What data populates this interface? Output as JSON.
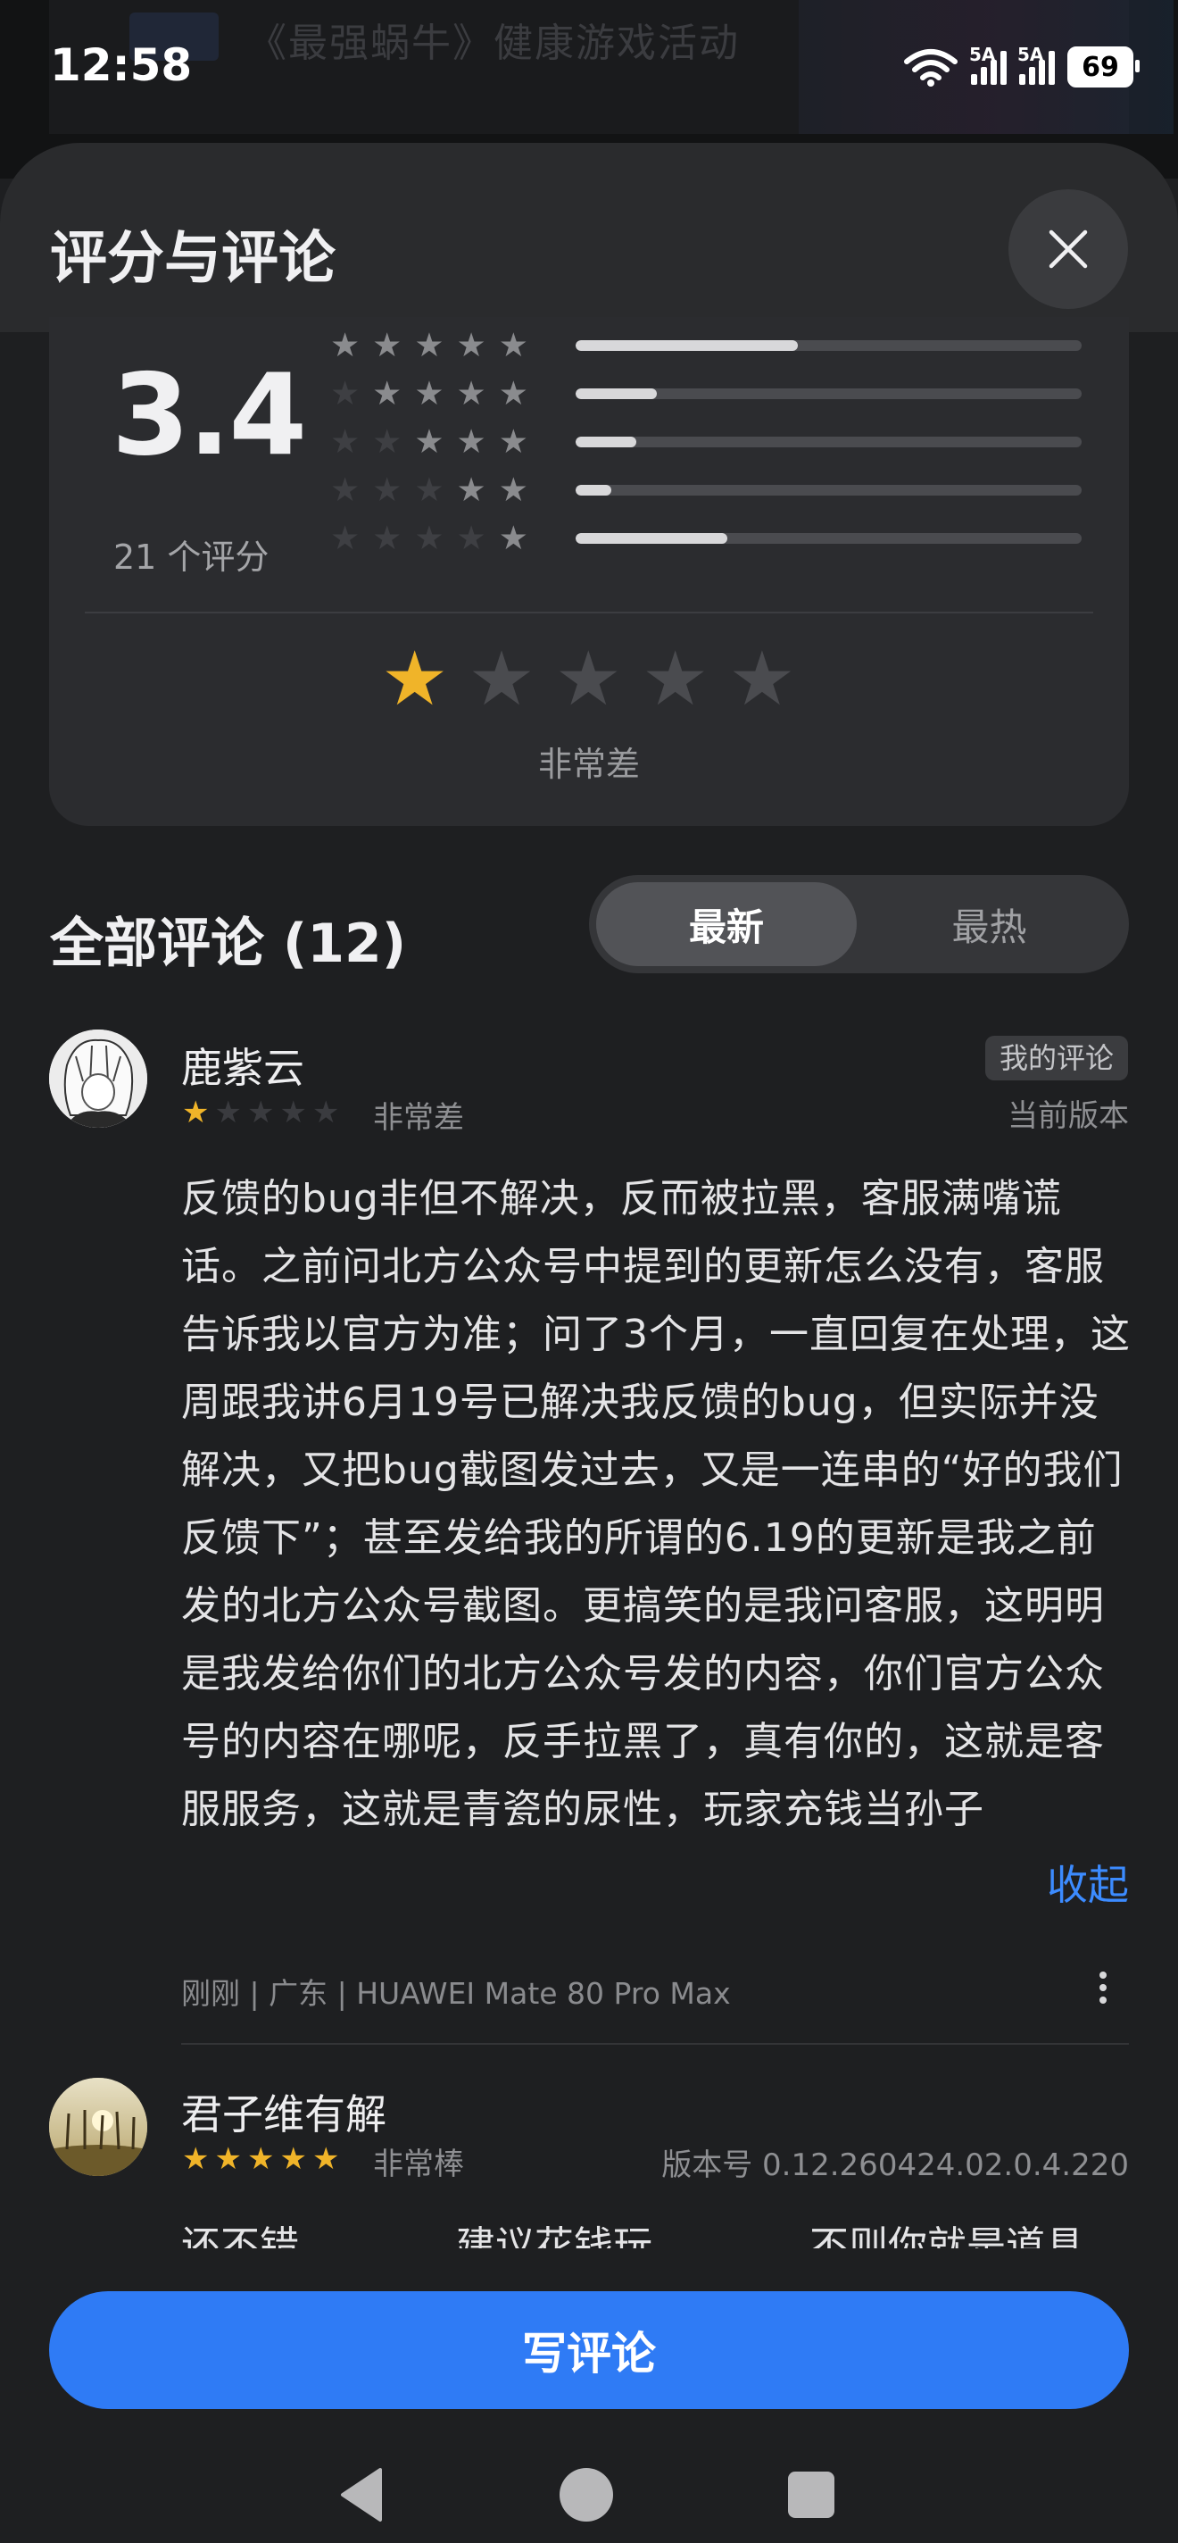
{
  "status_bar": {
    "time": "12:58",
    "battery": "69",
    "signal1_label": "5A",
    "signal2_label": "5A",
    "wifi_label": "6"
  },
  "background_app": {
    "title_text": "《最强蜗牛》健康游戏活动"
  },
  "sheet": {
    "title": "评分与评论"
  },
  "rating_summary": {
    "score": "3.4",
    "count_label": "21 个评分",
    "distribution": [
      {
        "stars": 5,
        "fraction": 0.44
      },
      {
        "stars": 4,
        "fraction": 0.16
      },
      {
        "stars": 3,
        "fraction": 0.12
      },
      {
        "stars": 2,
        "fraction": 0.07
      },
      {
        "stars": 1,
        "fraction": 0.3
      }
    ],
    "my_rating": 1,
    "my_rating_label": "非常差"
  },
  "comments_section": {
    "title": "全部评论 (12)",
    "sort_tabs": [
      {
        "label": "最新",
        "active": true
      },
      {
        "label": "最热",
        "active": false
      }
    ]
  },
  "comments": [
    {
      "name": "鹿紫云",
      "stars": 1,
      "level": "非常差",
      "badge": "我的评论",
      "version": "当前版本",
      "body": "反馈的bug非但不解决，反而被拉黑，客服满嘴谎话。之前问北方公众号中提到的更新怎么没有，客服告诉我以官方为准；问了3个月，一直回复在处理，这周跟我讲6月19号已解决我反馈的bug，但实际并没解决，又把bug截图发过去，又是一连串的“好的我们反馈下”；甚至发给我的所谓的6.19的更新是我之前发的北方公众号截图。更搞笑的是我问客服，这明明是我发给你们的北方公众号发的内容，你们官方公众号的内容在哪呢，反手拉黑了，真有你的，这就是客服服务，这就是青瓷的尿性，玩家充钱当孙子",
      "collapse_label": "收起",
      "meta": "刚刚 | 广东 | HUAWEI Mate 80 Pro Max"
    },
    {
      "name": "君子维有解",
      "stars": 5,
      "level": "非常棒",
      "version": "版本号 0.12.260424.02.0.4.220",
      "body": "还不错　　　　建议花钱玩　　　　不则你就是道具"
    }
  ],
  "write_button": {
    "label": "写评论"
  },
  "colors": {
    "accent": "#2f7bf5",
    "star_filled": "#f0b429",
    "star_empty": "#4a4b4f",
    "link": "#3c8bff"
  }
}
